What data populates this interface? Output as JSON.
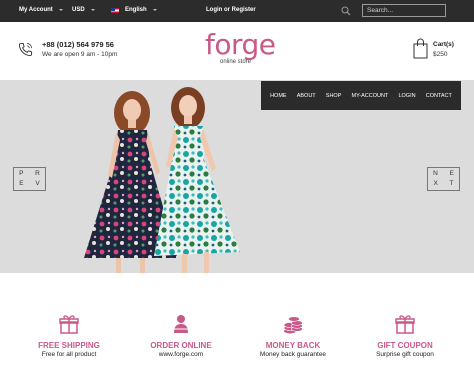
{
  "topbar": {
    "account_label": "My Account",
    "currency_label": "USD",
    "language_label": "English",
    "auth_label": "Login or Register",
    "search_placeholder": "Search..."
  },
  "header": {
    "phone": "+88 (012) 564 979 56",
    "hours": "We are open 9 am - 10pm",
    "logo": "forge",
    "logo_sub": "online store",
    "cart_label": "Cart(s)",
    "cart_total": "$250"
  },
  "nav": {
    "items": [
      "HOME",
      "ABOUT",
      "SHOP",
      "MY-ACCOUNT",
      "LOGIN",
      "CONTACT"
    ]
  },
  "slider": {
    "prev_letters": [
      "P R",
      "E V"
    ],
    "next_letters": [
      "N E",
      "X T"
    ]
  },
  "features": [
    {
      "title": "FREE SHIPPING",
      "desc": "Free for all product",
      "icon": "gift-icon"
    },
    {
      "title": "ORDER ONLINE",
      "desc": "www.forge.com",
      "icon": "person-icon"
    },
    {
      "title": "MONEY BACK",
      "desc": "Money back guarantee",
      "icon": "coins-icon"
    },
    {
      "title": "GIFT COUPON",
      "desc": "Surprise gift coupon",
      "icon": "gift-icon"
    }
  ],
  "colors": {
    "accent": "#c85a8a",
    "topbar_bg": "#2c2c2c",
    "hero_bg": "#dcdcdc"
  }
}
